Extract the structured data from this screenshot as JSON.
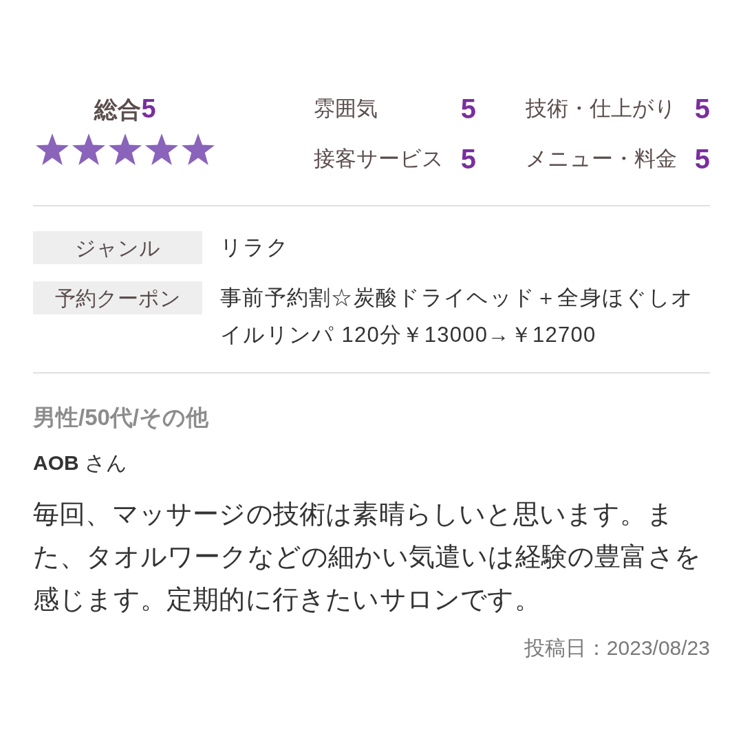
{
  "overall": {
    "label": "総合",
    "score": "5",
    "stars": 5
  },
  "ratings": [
    {
      "label": "雰囲気",
      "score": "5"
    },
    {
      "label": "技術・仕上がり",
      "score": "5"
    },
    {
      "label": "接客サービス",
      "score": "5"
    },
    {
      "label": "メニュー・料金",
      "score": "5"
    }
  ],
  "details": [
    {
      "label": "ジャンル",
      "value": "リラク"
    },
    {
      "label": "予約クーポン",
      "value": "事前予約割☆炭酸ドライヘッド＋全身ほぐしオイルリンパ 120分￥13000→￥12700"
    }
  ],
  "reviewer": {
    "profile": "男性/50代/その他",
    "name": "**AOB** さん"
  },
  "review": {
    "body": "毎回、マッサージの技術は素晴らしいと思います。また、タオルワークなどの細かい気遣いは経験の豊富さを感じます。定期的に行きたいサロンです。",
    "posted": "投稿日：2023/08/23"
  }
}
